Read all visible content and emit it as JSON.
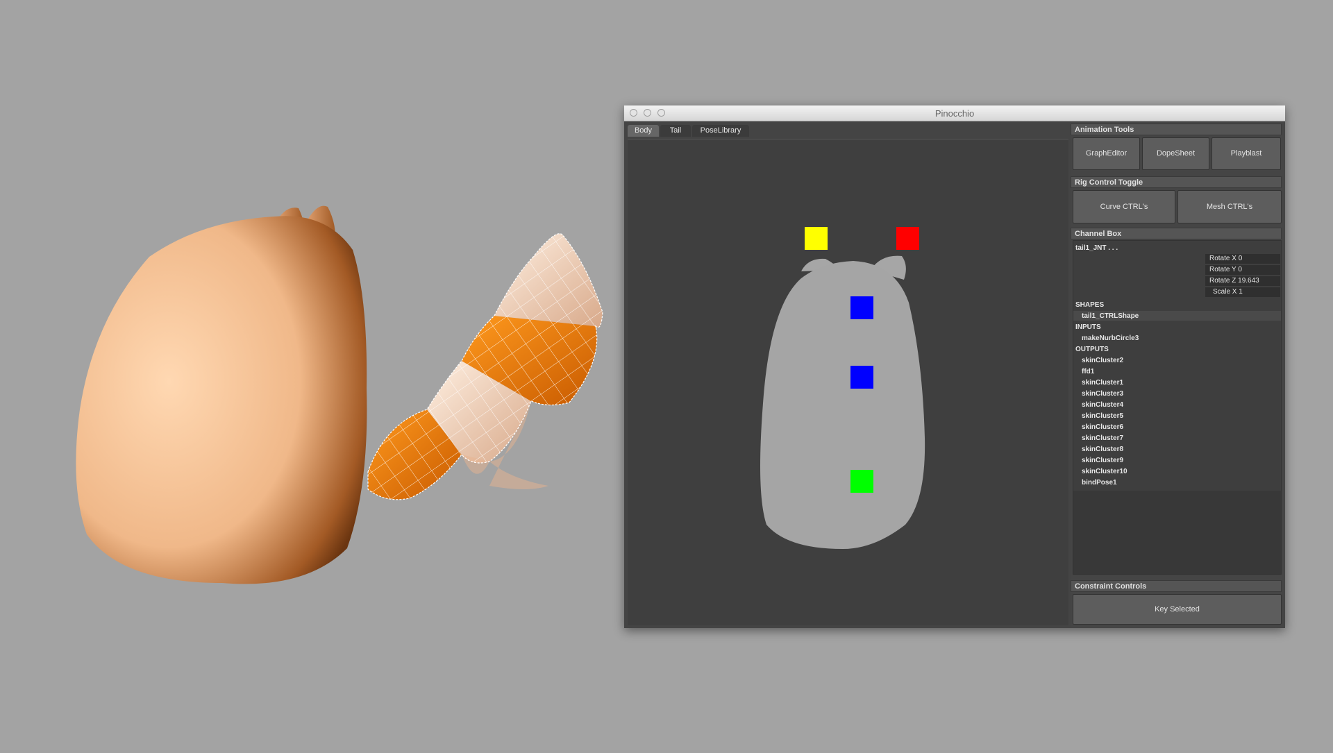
{
  "window": {
    "title": "Pinocchio"
  },
  "tabs": [
    {
      "label": "Body"
    },
    {
      "label": "Tail"
    },
    {
      "label": "PoseLibrary"
    }
  ],
  "picker_controls": [
    {
      "name": "control-yellow",
      "color": "#ffff00"
    },
    {
      "name": "control-red",
      "color": "#ff0000"
    },
    {
      "name": "control-blue-upper",
      "color": "#0000ff"
    },
    {
      "name": "control-blue-lower",
      "color": "#0000ff"
    },
    {
      "name": "control-green",
      "color": "#00ff00"
    }
  ],
  "animation_tools": {
    "header": "Animation Tools",
    "buttons": [
      {
        "label": "GraphEditor"
      },
      {
        "label": "DopeSheet"
      },
      {
        "label": "Playblast"
      }
    ]
  },
  "rig_control_toggle": {
    "header": "Rig Control Toggle",
    "buttons": [
      {
        "label": "Curve CTRL's"
      },
      {
        "label": "Mesh CTRL's"
      }
    ]
  },
  "channel_box": {
    "header": "Channel Box",
    "object": "tail1_JNT . . .",
    "attributes": [
      {
        "label": "Rotate X 0"
      },
      {
        "label": "Rotate Y 0"
      },
      {
        "label": "Rotate Z 19.643"
      },
      {
        "label": "Scale X 1"
      }
    ],
    "shapes_header": "SHAPES",
    "shapes": [
      "tail1_CTRLShape"
    ],
    "inputs_header": "INPUTS",
    "inputs": [
      "makeNurbCircle3"
    ],
    "outputs_header": "OUTPUTS",
    "outputs": [
      "skinCluster2",
      "ffd1",
      "skinCluster1",
      "skinCluster3",
      "skinCluster4",
      "skinCluster5",
      "skinCluster6",
      "skinCluster7",
      "skinCluster8",
      "skinCluster9",
      "skinCluster10",
      "bindPose1"
    ]
  },
  "constraint_controls": {
    "header": "Constraint Controls",
    "button": "Key Selected"
  }
}
